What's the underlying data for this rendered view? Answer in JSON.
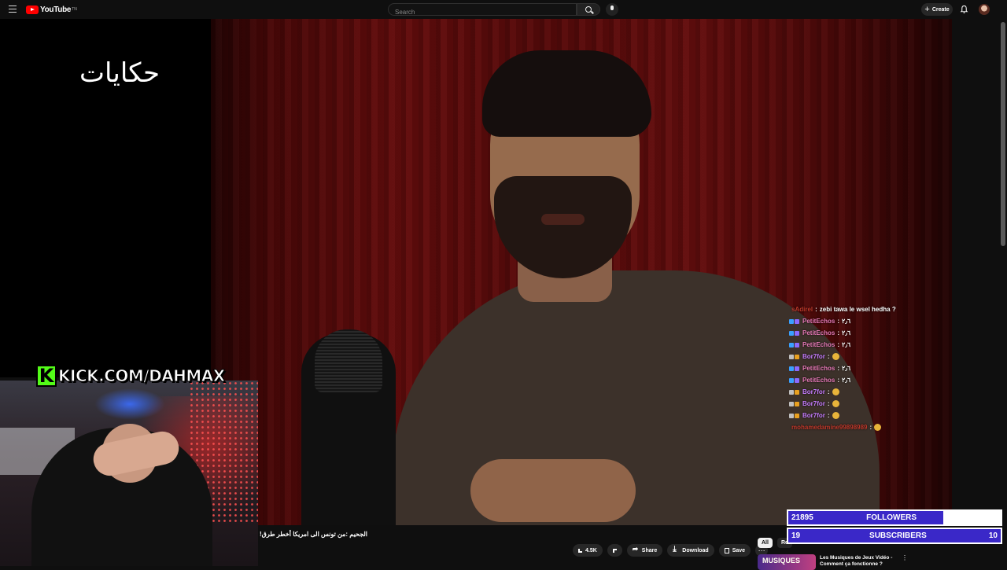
{
  "app": {
    "logo_text": "YouTube",
    "logo_suffix": "TN"
  },
  "search": {
    "placeholder": "Search"
  },
  "header": {
    "create_label": "Create"
  },
  "channel_logo_text": "حكايات",
  "chat": {
    "lines": [
      {
        "user": "sAdirel",
        "user_color": "#c0392b",
        "message": "zebi tawa le wsel hedha ?",
        "badges": []
      },
      {
        "user": "PetitEchos",
        "user_color": "#e87ab8",
        "message": "٢٫٦",
        "badges": [
          "#3aa0ff",
          "#8a6aff"
        ]
      },
      {
        "user": "PetitEchos",
        "user_color": "#e87ab8",
        "message": "٢٫٦",
        "badges": [
          "#3aa0ff",
          "#8a6aff"
        ]
      },
      {
        "user": "PetitEchos",
        "user_color": "#e87ab8",
        "message": "٢٫٦",
        "badges": [
          "#3aa0ff",
          "#8a6aff"
        ]
      },
      {
        "user": "Bor7for",
        "user_color": "#c77dff",
        "message": "",
        "badges": [
          "#c0c0c0",
          "#e8a020"
        ],
        "emote": true
      },
      {
        "user": "PetitEchos",
        "user_color": "#e87ab8",
        "message": "٢٫٦",
        "badges": [
          "#3aa0ff",
          "#8a6aff"
        ]
      },
      {
        "user": "PetitEchos",
        "user_color": "#e87ab8",
        "message": "٢٫٦",
        "badges": [
          "#3aa0ff",
          "#8a6aff"
        ]
      },
      {
        "user": "Bor7for",
        "user_color": "#c77dff",
        "message": "",
        "badges": [
          "#c0c0c0",
          "#e8a020"
        ],
        "emote": true
      },
      {
        "user": "Bor7for",
        "user_color": "#c77dff",
        "message": "",
        "badges": [
          "#c0c0c0",
          "#e8a020"
        ],
        "emote": true
      },
      {
        "user": "Bor7for",
        "user_color": "#c77dff",
        "message": "",
        "badges": [
          "#c0c0c0",
          "#e8a020"
        ],
        "emote": true
      },
      {
        "user": "mohamedamine99898989",
        "user_color": "#c0392b",
        "message": "",
        "badges": [],
        "emote": true
      }
    ]
  },
  "overlay": {
    "kick_letter": "K",
    "kick_text": "KICK.COM/DAHMAX"
  },
  "video": {
    "title": "الجحيم :من تونس الى امريكا أخطر طرق!"
  },
  "actions": {
    "likes": "4.5K",
    "share": "Share",
    "download": "Download",
    "save": "Save",
    "more": "⋯"
  },
  "chips": [
    {
      "label": "All",
      "active": true
    },
    {
      "label": "Re",
      "active": false
    }
  ],
  "recommendation": {
    "thumb_text": "MUSIQUES",
    "title": "Les Musiques de Jeux Vidéo - Comment ça fonctionne ?"
  },
  "goals": [
    {
      "current": "21895",
      "label": "FOLLOWERS",
      "target": "30000",
      "progress": 0.73
    },
    {
      "current": "19",
      "label": "SUBSCRIBERS",
      "target": "10",
      "progress": 1.0
    }
  ],
  "colors": {
    "brand_red": "#ff0000",
    "kick_green": "#53fc18",
    "goal_bar": "#3a28c8"
  }
}
